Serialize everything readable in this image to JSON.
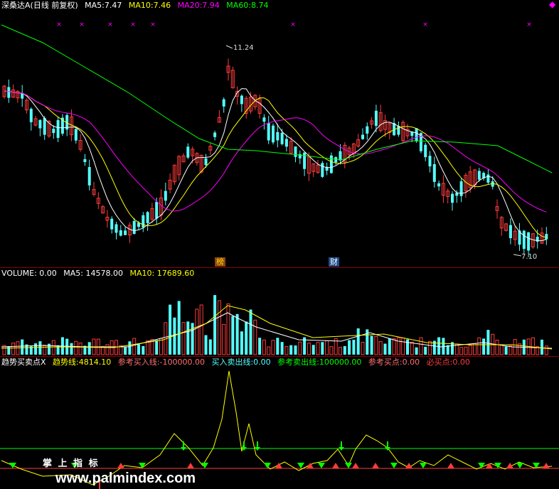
{
  "main": {
    "name": "深桑达A",
    "period": "(日线 前复权)",
    "ma5_label": "MA5:",
    "ma5": "7.47",
    "ma10_label": "MA10:",
    "ma10": "7.46",
    "ma20_label": "MA20:",
    "ma20": "7.94",
    "ma60_label": "MA60:",
    "ma60": "8.74",
    "high_mark": "11.24",
    "low_mark": "7.10",
    "badge1": "榜",
    "badge2": "财"
  },
  "volume": {
    "label": "VOLUME:",
    "value": "0.00",
    "ma5_label": "MA5:",
    "ma5": "14578.00",
    "ma10_label": "MA10:",
    "ma10": "17689.60"
  },
  "indicator": {
    "name": "趋势买卖点X",
    "trend_label": "趋势线:",
    "trend": "4814.10",
    "ref_buy_line_label": "参考买入线:",
    "ref_buy_line": "-100000.00",
    "buy_sell_line_label": "买入卖出线:",
    "buy_sell_line": "0.00",
    "ref_sell_line_label": "参考卖出线:",
    "ref_sell_line": "100000.00",
    "ref_buy_label": "参考买点:",
    "ref_buy": "0.00",
    "must_buy_label": "必买点:",
    "must_buy": "0.00",
    "watermark_text": "掌 上 指 标",
    "watermark_url": "www.palmindex.com"
  },
  "colors": {
    "up": "#ff3b3b",
    "down": "#54ffff",
    "ma5": "#ffffff",
    "ma10": "#ffff00",
    "ma20": "#ff00ff",
    "ma60": "#00ff00",
    "grid": "#8b0000"
  }
}
